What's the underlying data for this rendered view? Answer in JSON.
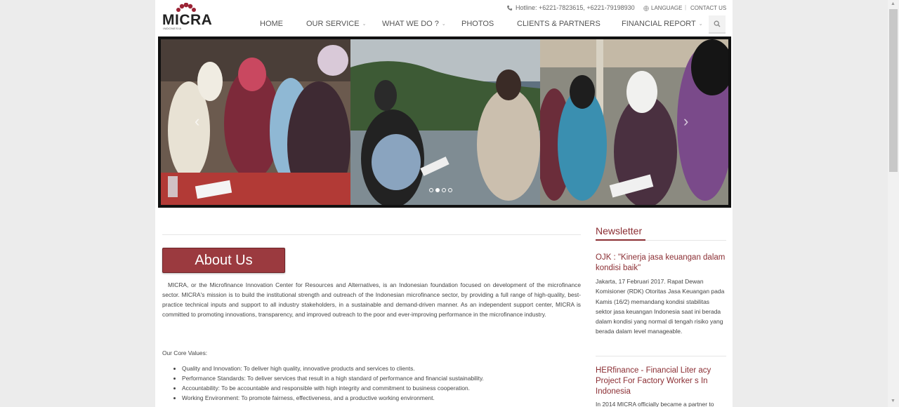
{
  "header": {
    "hotline": "Hotline: +6221-7823615, +6221-79198930",
    "language": "LANGUAGE",
    "separator": "|",
    "contact": "CONTACT US"
  },
  "logo": {
    "name": "MICRA",
    "sub": "INDONESIA"
  },
  "nav": {
    "items": [
      {
        "label": "HOME"
      },
      {
        "label": "OUR SERVICE"
      },
      {
        "label": "WHAT WE DO ?"
      },
      {
        "label": "PHOTOS"
      },
      {
        "label": "CLIENTS & PARTNERS"
      },
      {
        "label": "FINANCIAL REPORT"
      }
    ]
  },
  "slider": {
    "prev_icon": "‹",
    "next_icon": "›",
    "active_dot": 2
  },
  "about": {
    "heading": "About Us",
    "paragraph": "MICRA, or the Microfinance Innovation Center for Resources and Alternatives, is an Indonesian foundation focused on development of the microfinance sector. MICRA's mission is to build the institutional strength and outreach of the Indonesian microfinance sector, by providing a full range of high-quality, best-practice technical inputs and support to all industry stakeholders, in a sustainable and demand-driven manner. As an independent support center, MICRA is committed to promoting innovations, transparency, and improved outreach to the poor and ever-improving performance in the microfinance industry.",
    "core_title": "Our Core  Values:",
    "core_values": [
      "Quality and Innovation: To deliver high quality, innovative  products and services to clients.",
      "Performance Standards: To deliver services that  result  in a high standard of performance and financial sustainability.",
      "Accountability: To be accountable and responsible with high integrity and commitment to business cooperation.",
      "Working Environment: To promote fairness, effectiveness, and a productive working environment."
    ]
  },
  "newsletter": {
    "title": "Newsletter",
    "items": [
      {
        "title": "OJK : \"Kinerja jasa keuangan dalam kondisi baik\"",
        "body": "Jakarta, 17 Februari 2017. Rapat Dewan Komisioner (RDK) Otoritas Jasa Keuangan pada Kamis (16/2) memandang kondisi stabilitas sektor jasa keuangan Indonesia saat ini berada dalam kondisi yang normal di tengah risiko yang berada dalam level manageable."
      },
      {
        "title": "HERfinance - Financial Liter acy Project For Factory Worker s In Indonesia",
        "body": "In 2014 MICRA officially became a partner to"
      }
    ]
  },
  "colors": {
    "brand": "#8b2e33",
    "about_button": "#9b3a3f",
    "background": "#ececec"
  }
}
